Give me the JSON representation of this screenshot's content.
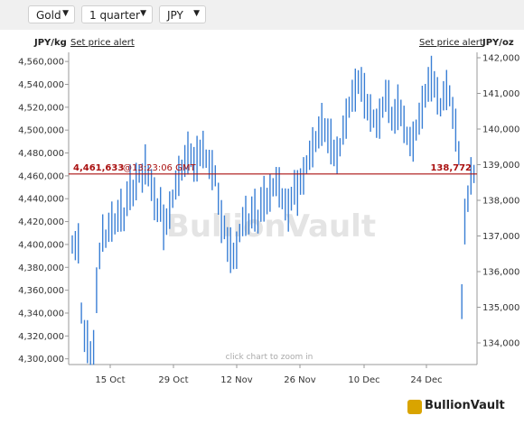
{
  "toolbar": {
    "metal": "Gold",
    "period": "1 quarter",
    "currency": "JPY"
  },
  "header": {
    "left_unit": "JPY/kg",
    "right_unit": "JPY/oz",
    "alert_left": "Set price alert",
    "alert_right": "Set price alert"
  },
  "footer": {
    "hint": "click chart to zoom in",
    "brand": "BullionVault"
  },
  "chart_data": {
    "type": "line",
    "watermark": "BullionVault",
    "x_tick_labels": [
      "15 Oct",
      "29 Oct",
      "12 Nov",
      "26 Nov",
      "10 Dec",
      "24 Dec"
    ],
    "y_left_ticks": [
      4300000,
      4320000,
      4340000,
      4360000,
      4380000,
      4400000,
      4420000,
      4440000,
      4460000,
      4480000,
      4500000,
      4520000,
      4540000,
      4560000
    ],
    "y_right_ticks": [
      134000,
      135000,
      136000,
      137000,
      138000,
      139000,
      140000,
      141000,
      142000
    ],
    "y_left_range": [
      4295000,
      4568000
    ],
    "current": {
      "value_kg": "4,461,633",
      "time": "@13:23:06 GMT",
      "value_oz": "138,772"
    },
    "line_color": "#3a7fd5",
    "ref_line_color": "#aa1111",
    "series": [
      {
        "values": [
          4400000,
          4399000,
          4401000,
          4340000,
          4320000,
          4315000,
          4305000,
          4310000,
          4360000,
          4390000,
          4410000,
          4405000,
          4415000,
          4420000,
          4418000,
          4425000,
          4430000,
          4422000,
          4440000,
          4450000,
          4445000,
          4455000,
          4462000,
          4458000,
          4470000,
          4460000,
          4452000,
          4440000,
          4430000,
          4435000,
          4415000,
          4420000,
          4430000,
          4440000,
          4452000,
          4460000,
          4465000,
          4473000,
          4480000,
          4478000,
          4470000,
          4475000,
          4480000,
          4483000,
          4475000,
          4470000,
          4465000,
          4460000,
          4440000,
          4420000,
          4415000,
          4400000,
          4395000,
          4390000,
          4395000,
          4410000,
          4420000,
          4425000,
          4418000,
          4428000,
          4430000,
          4420000,
          4435000,
          4440000,
          4438000,
          4445000,
          4450000,
          4455000,
          4450000,
          4440000,
          4435000,
          4430000,
          4440000,
          4450000,
          4445000,
          4455000,
          4460000,
          4470000,
          4478000,
          4485000,
          4490000,
          4498000,
          4505000,
          4500000,
          4495000,
          4490000,
          4480000,
          4478000,
          4485000,
          4500000,
          4510000,
          4520000,
          4530000,
          4535000,
          4542000,
          4540000,
          4530000,
          4520000,
          4515000,
          4510000,
          4506000,
          4510000,
          4520000,
          4530000,
          4525000,
          4510000,
          4512000,
          4520000,
          4515000,
          4505000,
          4495000,
          4490000,
          4490000,
          4500000,
          4510000,
          4520000,
          4530000,
          4540000,
          4545000,
          4540000,
          4530000,
          4520000,
          4530000,
          4535000,
          4530000,
          4515000,
          4500000,
          4480000,
          4350000,
          4420000,
          4440000,
          4460000,
          4461633
        ]
      }
    ]
  }
}
